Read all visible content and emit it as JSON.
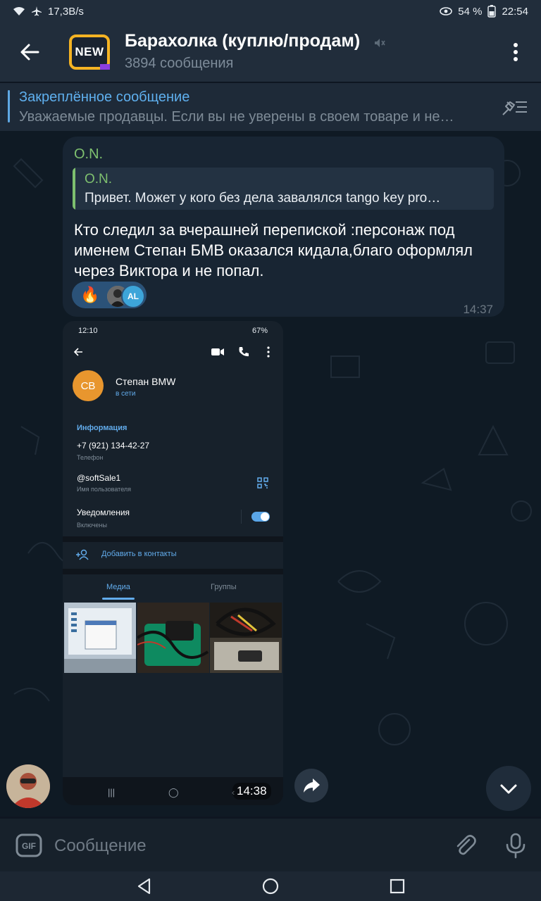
{
  "statusbar": {
    "speed": "17,3B/s",
    "battery": "54 %",
    "time": "22:54"
  },
  "header": {
    "avatar_text": "NEW",
    "title": "Барахолка (куплю/продам)",
    "subtitle": "3894 сообщения"
  },
  "pinned": {
    "title": "Закреплённое сообщение",
    "text": "Уважаемые продавцы.  Если вы не уверены в своем товаре и не…"
  },
  "message1": {
    "sender": "O.N.",
    "reply": {
      "name": "O.N.",
      "text": "Привет. Может у кого без дела завалялся tango key pro…"
    },
    "text": "Кто следил за вчерашней перепиской :персонаж под именем Степан БМВ оказался кидала,благо оформлял через Виктора и не попал.",
    "reactions": {
      "emoji": "🔥",
      "avatar2_initials": "AL"
    },
    "time": "14:37"
  },
  "message2": {
    "time": "14:38",
    "screenshot": {
      "status_time": "12:10",
      "status_battery": "67%",
      "avatar_initials": "СВ",
      "contact_name": "Степан BMW",
      "contact_status": "в сети",
      "info_header": "Информация",
      "phone": "+7 (921) 134-42-27",
      "phone_label": "Телефон",
      "username": "@softSale1",
      "username_label": "Имя пользователя",
      "notifications": "Уведомления",
      "notifications_state": "Включены",
      "add_contact": "Добавить в контакты",
      "tab_media": "Медиа",
      "tab_groups": "Группы"
    }
  },
  "input": {
    "placeholder": "Сообщение",
    "value": ""
  },
  "icons": {
    "back": "arrow-left-icon",
    "mute": "muted-speaker-icon",
    "menu": "three-dots-icon",
    "unpin": "unpin-list-icon",
    "forward": "share-arrow-icon",
    "scroll_down": "chevron-down-icon",
    "gif": "gif-icon",
    "attach": "paperclip-icon",
    "mic": "microphone-icon"
  },
  "colors": {
    "header_bg": "#212d3b",
    "chat_bg": "#0f1a24",
    "bubble_bg": "#182533",
    "accent_blue": "#5fb0ef",
    "sender_green": "#7ec06f",
    "avatar_border": "#f5b323"
  }
}
